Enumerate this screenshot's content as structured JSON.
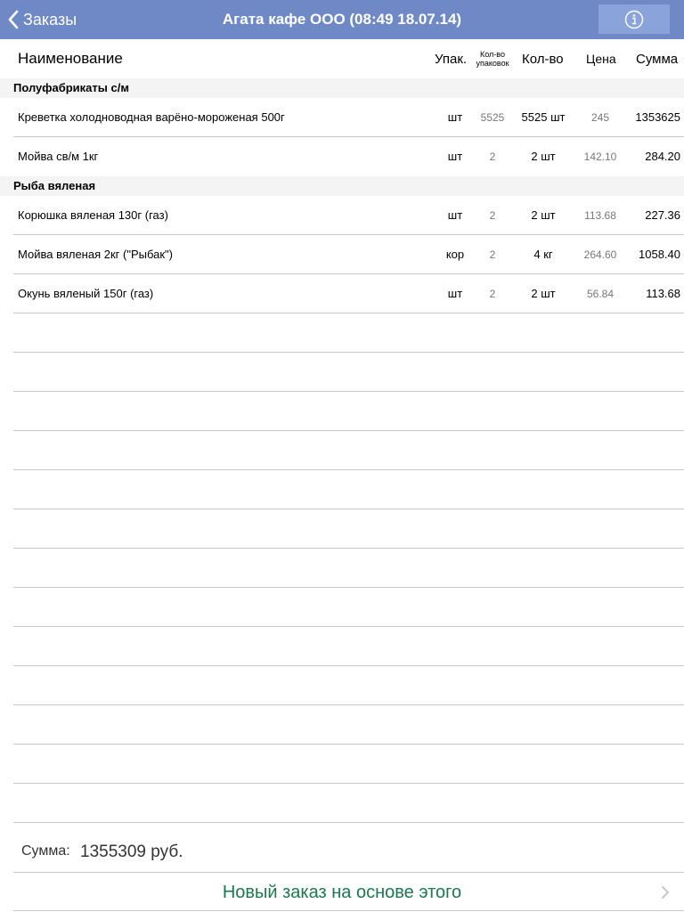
{
  "navbar": {
    "back_label": "Заказы",
    "title": "Агата кафе ООО (08:49 18.07.14)",
    "info_icon": "info-icon",
    "color": "#6f88c6"
  },
  "table": {
    "headers": {
      "name": "Наименование",
      "pack": "Упак.",
      "npack": "Кол-во упаковок",
      "qty": "Кол-во",
      "price": "Цена",
      "sum": "Сумма"
    },
    "groups": [
      {
        "title": "Полуфабрикаты с/м",
        "rows": [
          {
            "name": "Креветка холодноводная варёно-мороженая 500г",
            "pack": "шт",
            "npack": "5525",
            "qty": "5525 шт",
            "price": "245",
            "sum": "1353625"
          },
          {
            "name": "Мойва св/м 1кг",
            "pack": "шт",
            "npack": "2",
            "qty": "2 шт",
            "price": "142.10",
            "sum": "284.20"
          }
        ]
      },
      {
        "title": "Рыба вяленая",
        "rows": [
          {
            "name": "Корюшка вяленая 130г (газ)",
            "pack": "шт",
            "npack": "2",
            "qty": "2 шт",
            "price": "113.68",
            "sum": "227.36"
          },
          {
            "name": "Мойва вяленая 2кг (\"Рыбак\")",
            "pack": "кор",
            "npack": "2",
            "qty": "4 кг",
            "price": "264.60",
            "sum": "1058.40"
          },
          {
            "name": "Окунь вяленый 150г (газ)",
            "pack": "шт",
            "npack": "2",
            "qty": "2 шт",
            "price": "56.84",
            "sum": "113.68"
          }
        ]
      }
    ]
  },
  "footer": {
    "total_label": "Сумма:",
    "total_value": "1355309 руб.",
    "action_label": "Новый заказ на основе этого",
    "action_color": "#1a7a4e"
  }
}
